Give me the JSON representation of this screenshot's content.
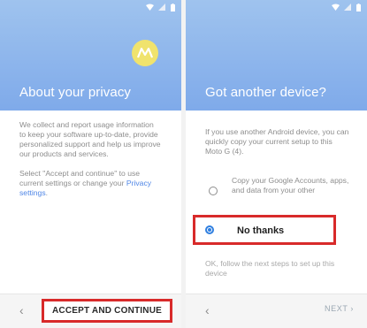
{
  "left_screen": {
    "title": "About your privacy",
    "paragraph1": "We collect and report usage information to keep your software up-to-date, provide personalized support and help us improve our products and services.",
    "paragraph2_prefix": "Select \"Accept and continue\" to use current settings or change your ",
    "paragraph2_link": "Privacy settings",
    "paragraph2_suffix": ".",
    "back_icon": "chevron-left-icon",
    "accept_button": "ACCEPT AND CONTINUE",
    "logo": "motorola-logo"
  },
  "right_screen": {
    "title": "Got another device?",
    "intro": "If you use another Android device, you can quickly copy your current setup to this Moto G (4).",
    "option_copy": "Copy your Google Accounts, apps, and data from your other",
    "option_no": "No thanks",
    "footer_text": "OK, follow the next steps to set up this device",
    "back_icon": "chevron-left-icon",
    "next_button": "NEXT",
    "next_icon": "chevron-right-icon"
  },
  "colors": {
    "header_blue": "#86b1ec",
    "highlight_red": "#d82a2a",
    "selected_blue": "#2f7fe0",
    "logo_yellow": "#f0e36d"
  }
}
